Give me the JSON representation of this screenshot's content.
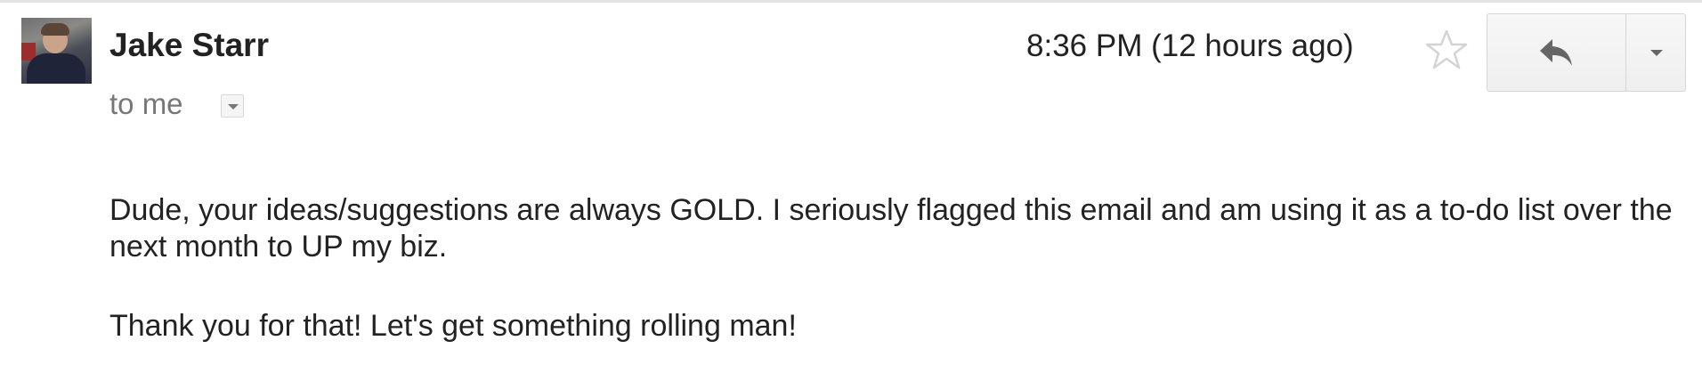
{
  "email": {
    "sender_name": "Jake Starr",
    "recipient_text": "to me",
    "timestamp": "8:36 PM (12 hours ago)",
    "body_paragraphs": [
      "Dude, your ideas/suggestions are always GOLD. I seriously flagged this email and am using it as a to-do list over the next month to UP my biz.",
      "Thank you for that! Let's get something rolling man!"
    ]
  },
  "icons": {
    "star": "star-outline-icon",
    "reply": "reply-arrow-icon",
    "more": "chevron-down-icon",
    "details": "show-details-icon"
  },
  "colors": {
    "text_primary": "#222222",
    "text_secondary": "#777777",
    "star_outline": "#d4d4d4",
    "button_border": "#d6d6d6"
  }
}
